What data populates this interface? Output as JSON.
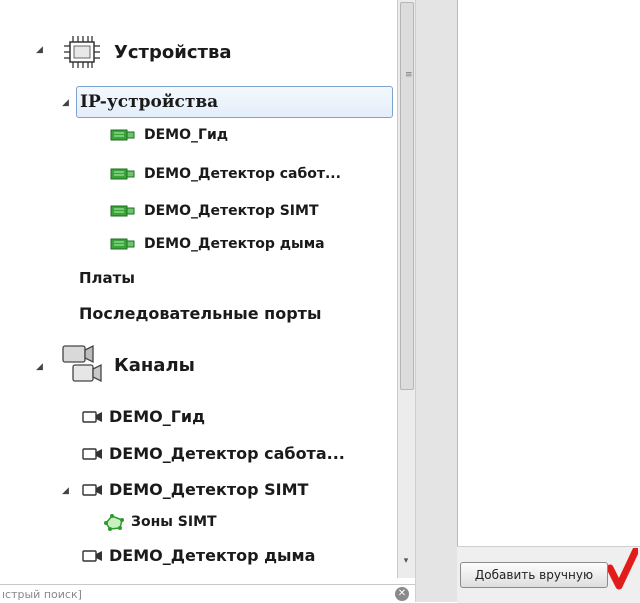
{
  "tree": {
    "devices_label": "Устройства",
    "ip_devices_label": "IP-устройства",
    "ip_items": [
      "DEMO_Гид",
      "DEMO_Детектор сабот...",
      "DEMO_Детектор SIMT",
      "DEMO_Детектор дыма"
    ],
    "boards_label": "Платы",
    "serial_ports_label": "Последовательные порты",
    "channels_label": "Каналы",
    "channel_items": [
      "DEMO_Гид",
      "DEMO_Детектор сабота...",
      "DEMO_Детектор SIMT",
      "DEMO_Детектор дыма"
    ],
    "simt_zones_label": "Зоны SIMT"
  },
  "search": {
    "value": "ıстрый поиск]"
  },
  "buttons": {
    "add_manually": "Добавить вручную"
  },
  "colors": {
    "selection_border": "#7da2ce",
    "device_green": "#3aa33a",
    "check_red": "#e21b1b"
  }
}
